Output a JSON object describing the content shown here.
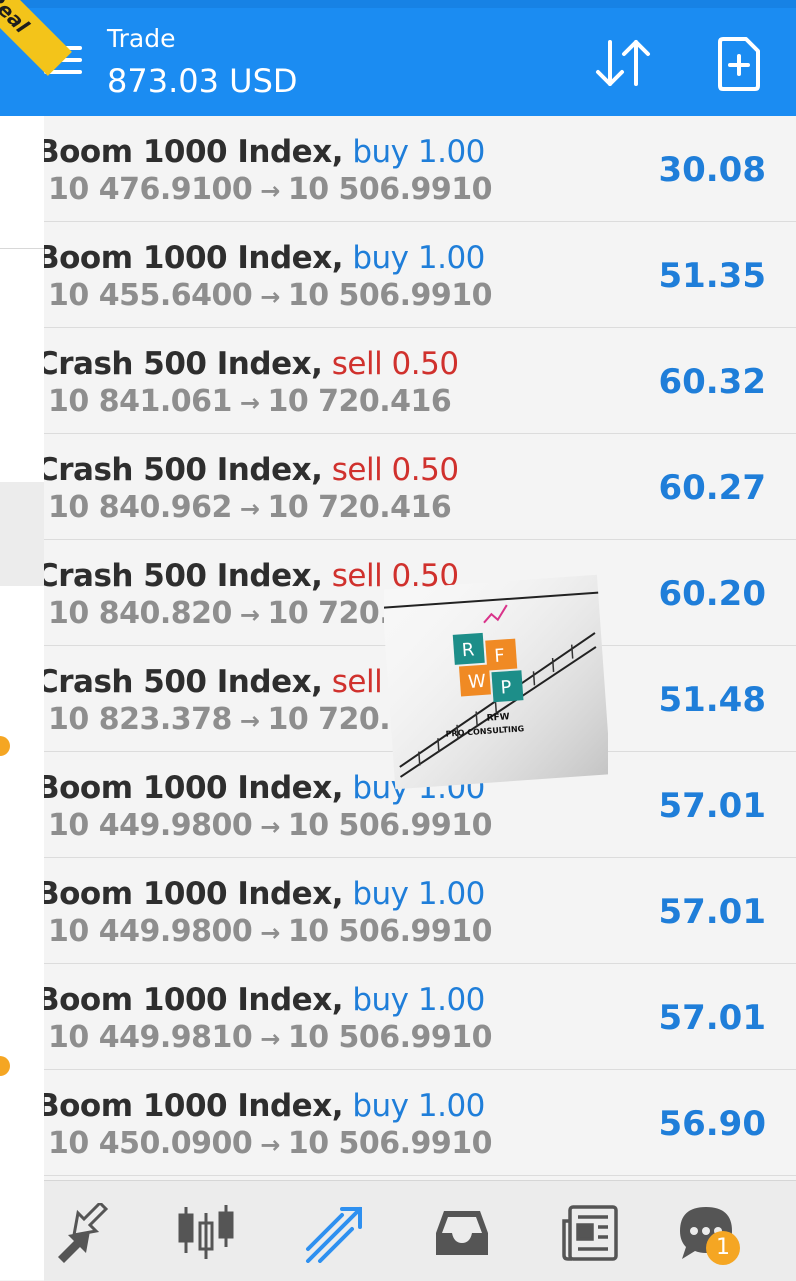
{
  "account_badge": "Real",
  "header": {
    "title": "Trade",
    "balance": "873.03 USD"
  },
  "positions": [
    {
      "symbol": "Boom 1000 Index,",
      "side": "buy 1.00",
      "type": "buy",
      "open_price": "10 476.9100",
      "current_price": "10 506.9910",
      "profit": "30.08"
    },
    {
      "symbol": "Boom 1000 Index,",
      "side": "buy 1.00",
      "type": "buy",
      "open_price": "10 455.6400",
      "current_price": "10 506.9910",
      "profit": "51.35"
    },
    {
      "symbol": "Crash 500 Index,",
      "side": "sell 0.50",
      "type": "sell",
      "open_price": "10 841.061",
      "current_price": "10 720.416",
      "profit": "60.32"
    },
    {
      "symbol": "Crash 500 Index,",
      "side": "sell 0.50",
      "type": "sell",
      "open_price": "10 840.962",
      "current_price": "10 720.416",
      "profit": "60.27"
    },
    {
      "symbol": "Crash 500 Index,",
      "side": "sell 0.50",
      "type": "sell",
      "open_price": "10 840.820",
      "current_price": "10 720.416",
      "profit": "60.20"
    },
    {
      "symbol": "Crash 500 Index,",
      "side": "sell 0.50",
      "type": "sell",
      "open_price": "10 823.378",
      "current_price": "10 720.416",
      "profit": "51.48"
    },
    {
      "symbol": "Boom 1000 Index,",
      "side": "buy 1.00",
      "type": "buy",
      "open_price": "10 449.9800",
      "current_price": "10 506.9910",
      "profit": "57.01"
    },
    {
      "symbol": "Boom 1000 Index,",
      "side": "buy 1.00",
      "type": "buy",
      "open_price": "10 449.9800",
      "current_price": "10 506.9910",
      "profit": "57.01"
    },
    {
      "symbol": "Boom 1000 Index,",
      "side": "buy 1.00",
      "type": "buy",
      "open_price": "10 449.9810",
      "current_price": "10 506.9910",
      "profit": "57.01"
    },
    {
      "symbol": "Boom 1000 Index,",
      "side": "buy 1.00",
      "type": "buy",
      "open_price": "10 450.0900",
      "current_price": "10 506.9910",
      "profit": "56.90"
    }
  ],
  "arrow_glyph": "→",
  "logo": {
    "letters": [
      "R",
      "F",
      "W",
      "P"
    ],
    "line1": "RFW",
    "line2": "PRO CONSULTING"
  },
  "bottom_nav": {
    "items": [
      "quotes-icon",
      "chart-icon",
      "trade-icon",
      "history-icon",
      "news-icon",
      "chat-icon"
    ],
    "active": "trade-icon",
    "chat_badge": "1"
  },
  "colors": {
    "header": "#1b8cf2",
    "buy": "#1f7ed9",
    "sell": "#d0312d",
    "profit": "#1f7ed9",
    "badge": "#f5a623"
  }
}
